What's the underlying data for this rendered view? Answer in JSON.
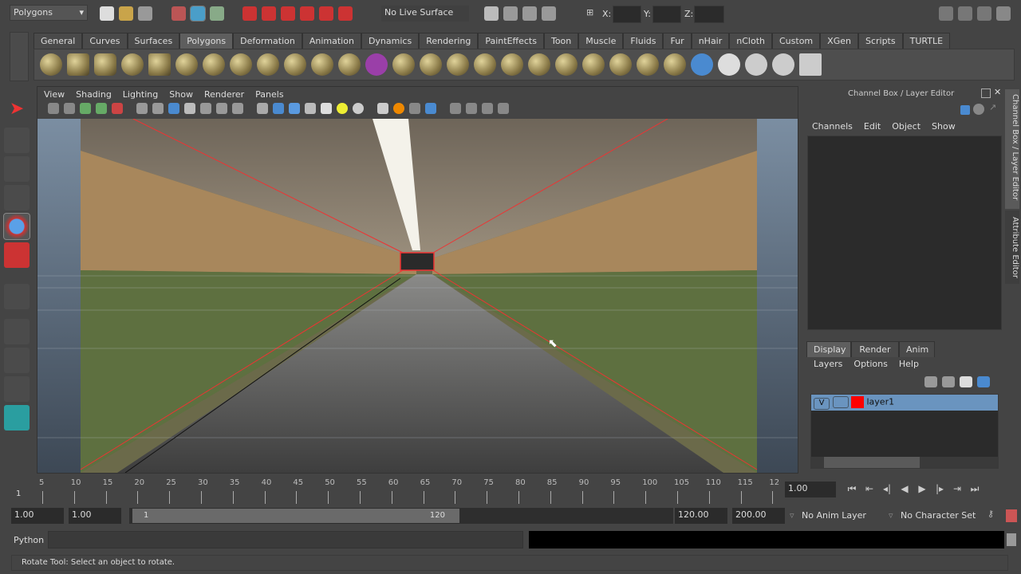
{
  "status_line": {
    "menu_set": "Polygons",
    "live_surface": "No Live Surface",
    "x_label": "X:",
    "y_label": "Y:",
    "z_label": "Z:"
  },
  "shelf": {
    "tabs": [
      "General",
      "Curves",
      "Surfaces",
      "Polygons",
      "Deformation",
      "Animation",
      "Dynamics",
      "Rendering",
      "PaintEffects",
      "Toon",
      "Muscle",
      "Fluids",
      "Fur",
      "nHair",
      "nCloth",
      "Custom",
      "XGen",
      "Scripts",
      "TURTLE"
    ],
    "active": "Polygons"
  },
  "viewport": {
    "menu": [
      "View",
      "Shading",
      "Lighting",
      "Show",
      "Renderer",
      "Panels"
    ]
  },
  "channel_box": {
    "title": "Channel Box / Layer Editor",
    "menu": [
      "Channels",
      "Edit",
      "Object",
      "Show"
    ],
    "side_tabs": [
      "Channel Box / Layer Editor",
      "Attribute Editor"
    ]
  },
  "layer_editor": {
    "tabs": [
      "Display",
      "Render",
      "Anim"
    ],
    "menu": [
      "Layers",
      "Options",
      "Help"
    ],
    "layers": [
      {
        "visible": "V",
        "name": "layer1",
        "color": "#ff0000"
      }
    ]
  },
  "timeline": {
    "ticks": [
      "5",
      "10",
      "15",
      "20",
      "25",
      "30",
      "35",
      "40",
      "45",
      "50",
      "55",
      "60",
      "65",
      "70",
      "75",
      "80",
      "85",
      "90",
      "95",
      "100",
      "105",
      "110",
      "115",
      "12"
    ],
    "start_marker": "1",
    "current_frame": "1.00"
  },
  "range": {
    "start": "1.00",
    "playback_start": "1.00",
    "slider_start": "1",
    "slider_end": "120",
    "playback_end": "120.00",
    "end": "200.00",
    "anim_layer": "No Anim Layer",
    "character_set": "No Character Set"
  },
  "command_line": {
    "label": "Python",
    "value": ""
  },
  "help_line": {
    "text": "Rotate Tool: Select an object to rotate."
  }
}
